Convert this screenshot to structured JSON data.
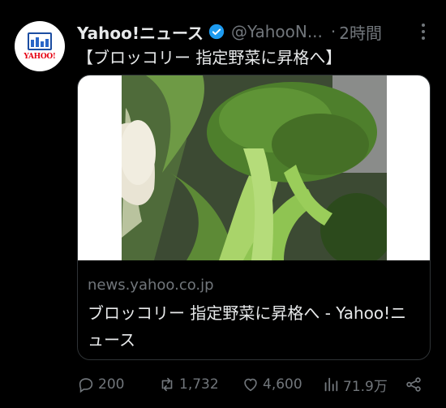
{
  "account": {
    "name": "Yahoo!ニュース",
    "handle": "@YahooN...",
    "time_sep": "·",
    "time": "2時間",
    "avatar_text": "YAHOO!"
  },
  "tweet": {
    "text": "【ブロッコリー 指定野菜に昇格へ】"
  },
  "card": {
    "domain": "news.yahoo.co.jp",
    "title": "ブロッコリー 指定野菜に昇格へ - Yahoo!ニュース",
    "image_alt": "broccoli"
  },
  "actions": {
    "replies": "200",
    "reposts": "1,732",
    "likes": "4,600",
    "views": "71.9万"
  },
  "colors": {
    "background": "#000000",
    "text": "#e7e9ea",
    "muted": "#71767b",
    "verified": "#1d9bf0"
  }
}
